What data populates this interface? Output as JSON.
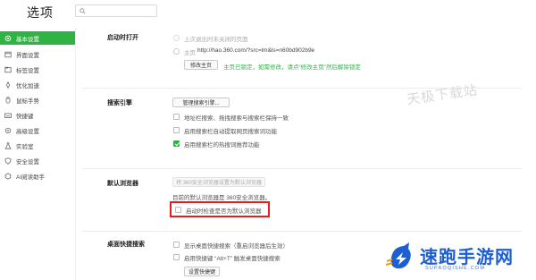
{
  "header": {
    "title": "选项",
    "search_placeholder": ""
  },
  "sidebar": {
    "items": [
      {
        "label": "基本设置",
        "icon": "gear-icon",
        "active": true
      },
      {
        "label": "界面设置",
        "icon": "window-icon"
      },
      {
        "label": "标签设置",
        "icon": "tag-icon"
      },
      {
        "label": "优化加速",
        "icon": "rocket-icon"
      },
      {
        "label": "鼠标手势",
        "icon": "mouse-icon"
      },
      {
        "label": "快捷键",
        "icon": "keyboard-icon"
      },
      {
        "label": "高级设置",
        "icon": "advanced-settings-icon"
      },
      {
        "label": "实验室",
        "icon": "flask-icon"
      },
      {
        "label": "安全设置",
        "icon": "shield-icon"
      },
      {
        "label": "AI阅读助手",
        "icon": "ai-icon"
      }
    ]
  },
  "startup": {
    "label": "启动时打开",
    "option_last": "上次退出时未关闭的页面",
    "option_home_prefix": "主页",
    "home_url": "http://hao.360.com/?src=lm&ls=n60bd902b9e",
    "modify_button": "修改主页",
    "locked_note": "主页已锁定，如需修改，请点“修改主页”然后解除锁定"
  },
  "search_engine": {
    "label": "搜索引擎",
    "manage_button": "管理搜索引擎...",
    "options": [
      {
        "label": "地址栏搜索、拖拽搜索与搜索栏保持一致",
        "checked": false
      },
      {
        "label": "启用搜索栏自动提取网页搜索词功能",
        "checked": false
      },
      {
        "label": "启用搜索栏的热搜词推荐功能",
        "checked": true
      }
    ]
  },
  "default_browser": {
    "label": "默认浏览器",
    "set_button": "将 360安全浏览器设置为默认浏览器",
    "current_text": "目前的默认浏览器是 360安全浏览器。",
    "check_option": "启动时检查是否为默认浏览器"
  },
  "desktop_shortcut": {
    "label": "桌面快捷搜索",
    "options": [
      {
        "label": "显示桌面快捷搜索（重启浏览器后生效）",
        "checked": false
      },
      {
        "label": "启用快捷键 “Alt+T” 触发桌面快捷搜索",
        "checked": false
      }
    ],
    "shortcut_button": "设置快捷键"
  },
  "overlay": {
    "watermark": "天极下载站",
    "brand_name": "速跑手游网",
    "brand_sub": "SUPAOQISHE.COM"
  },
  "colors": {
    "accent": "#2fb344",
    "highlight": "#e02020",
    "brand": "#1d5fd0"
  }
}
